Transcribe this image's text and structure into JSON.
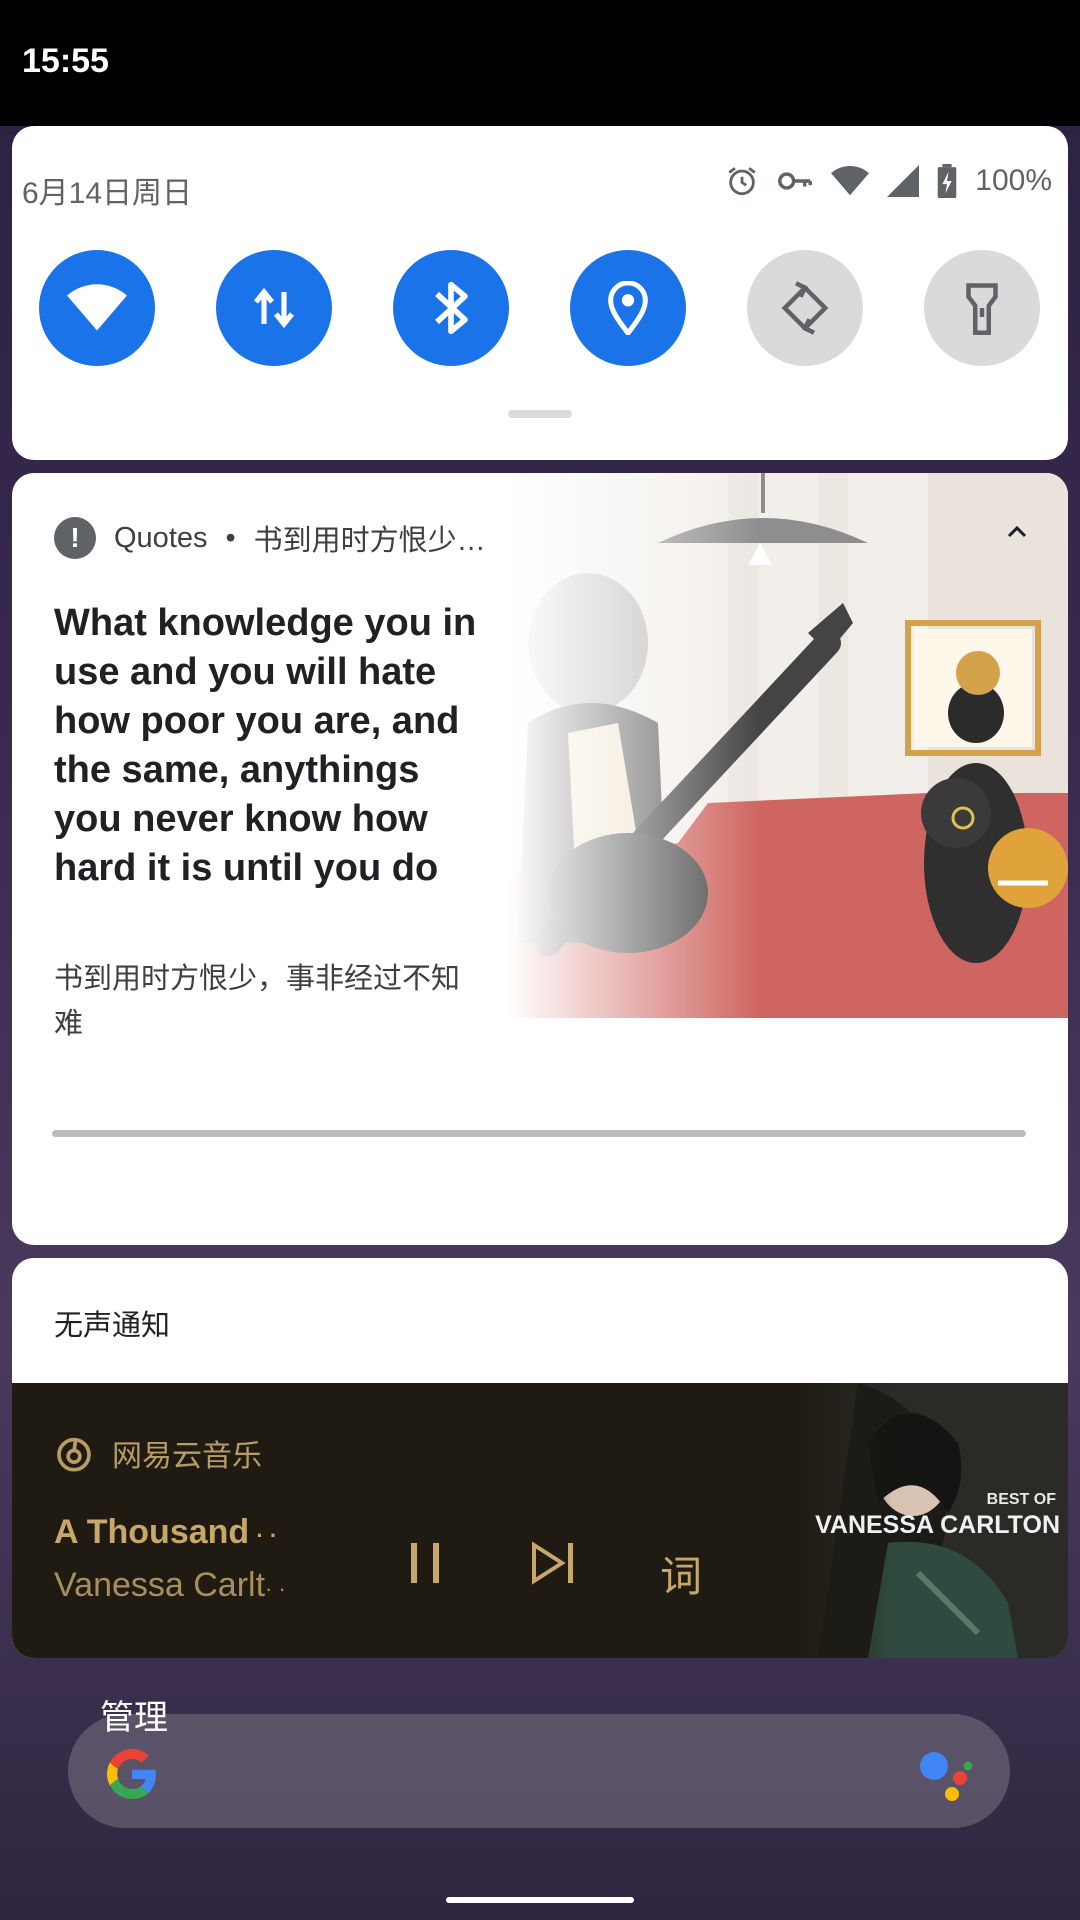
{
  "status_bar": {
    "time": "15:55"
  },
  "quick_settings": {
    "date": "6月14日周日",
    "battery": "100%",
    "status_icons": [
      "alarm-icon",
      "vpn-key-icon",
      "wifi-signal-icon",
      "cell-signal-icon",
      "battery-charging-icon"
    ],
    "tiles": [
      {
        "name": "wifi",
        "icon": "wifi-icon",
        "active": true
      },
      {
        "name": "mobile-data",
        "icon": "data-arrows-icon",
        "active": true
      },
      {
        "name": "bluetooth",
        "icon": "bluetooth-icon",
        "active": true
      },
      {
        "name": "location",
        "icon": "location-pin-icon",
        "active": true
      },
      {
        "name": "auto-rotate",
        "icon": "rotate-icon",
        "active": false
      },
      {
        "name": "flashlight",
        "icon": "flashlight-icon",
        "active": false
      }
    ],
    "accent_color": "#1a73e8"
  },
  "notification": {
    "app": "Quotes",
    "separator": "•",
    "header_text": "书到用时方恨少…",
    "title": "What knowledge you in use and you will hate how poor you are, and the same, anythings you never know how hard it is until you do",
    "text": "书到用时方恨少，事非经过不知难"
  },
  "silent_section": {
    "label": "无声通知",
    "media": {
      "app": "网易云音乐",
      "title": "A Thousand",
      "artist": "Vanessa Carlt",
      "ellipsis": "· ·",
      "lyrics_label": "词",
      "album_art_text_1": "BEST OF",
      "album_art_text_2": "VANESSA CARLTON",
      "accent_color": "#c8a86a"
    }
  },
  "manage_label": "管理"
}
